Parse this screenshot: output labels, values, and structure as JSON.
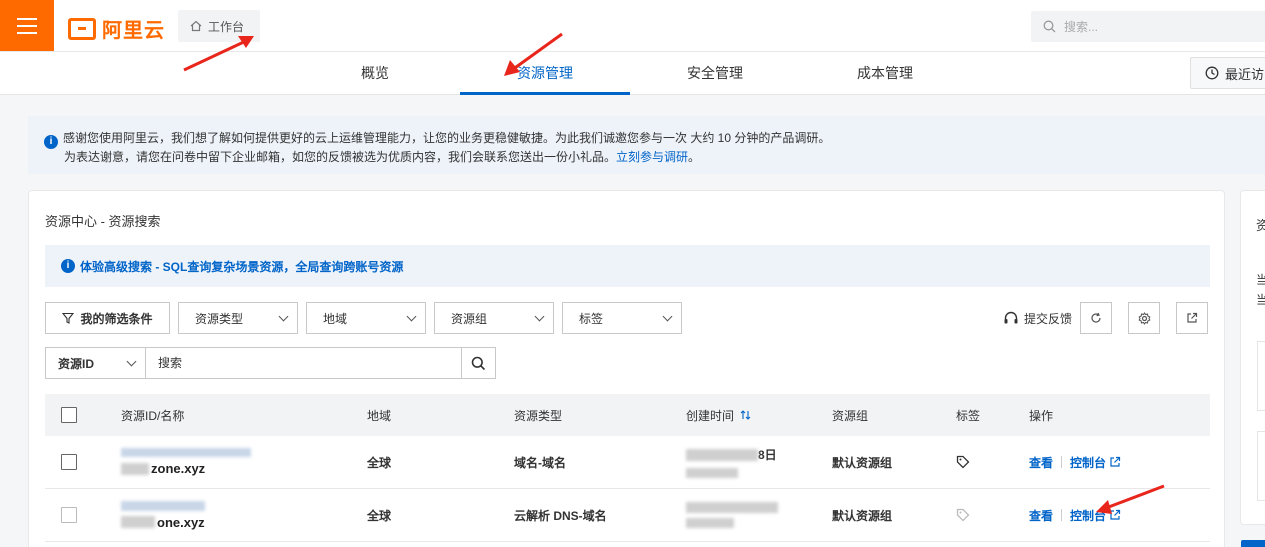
{
  "topbar": {
    "logo_text": "阿里云",
    "workbench_label": "工作台",
    "search_placeholder": "搜索..."
  },
  "tabs": {
    "overview": "概览",
    "resource": "资源管理",
    "security": "安全管理",
    "cost": "成本管理",
    "recent": "最近访问"
  },
  "notice": {
    "line1": "感谢您使用阿里云，我们想了解如何提供更好的云上运维管理能力，让您的业务更稳健敏捷。为此我们诚邀您参与一次 大约 10 分钟的产品调研。",
    "line2": "为表达谢意，请您在问卷中留下企业邮箱，如您的反馈被选为优质内容，我们会联系您送出一份小礼品。",
    "link": "立刻参与调研",
    "end": "。"
  },
  "card": {
    "title": "资源中心 - 资源搜索",
    "adv_search": "体验高级搜索 - SQL查询复杂场景资源，全局查询跨账号资源"
  },
  "filters": {
    "my_filters": "我的筛选条件",
    "resource_type": "资源类型",
    "region": "地域",
    "resource_group": "资源组",
    "tag": "标签",
    "feedback": "提交反馈"
  },
  "search": {
    "field": "资源ID",
    "placeholder": "搜索"
  },
  "table": {
    "headers": {
      "id_name": "资源ID/名称",
      "region": "地域",
      "type": "资源类型",
      "created": "创建时间",
      "group": "资源组",
      "tag": "标签",
      "ops": "操作"
    },
    "rows": [
      {
        "name_suffix": "zone.xyz",
        "region": "全球",
        "type": "域名-域名",
        "created_suffix": "8日",
        "group": "默认资源组",
        "view": "查看",
        "console": "控制台"
      },
      {
        "name_suffix": "one.xyz",
        "region": "全球",
        "type": "云解析 DNS-域名",
        "created_suffix": "",
        "group": "默认资源组",
        "view": "查看",
        "console": "控制台"
      }
    ]
  },
  "side": {
    "t1": "资",
    "t2": "当",
    "t3": "当"
  },
  "colors": {
    "brand": "#ff6a00",
    "primary": "#0064c8",
    "annotation_arrow": "#e8261c"
  }
}
